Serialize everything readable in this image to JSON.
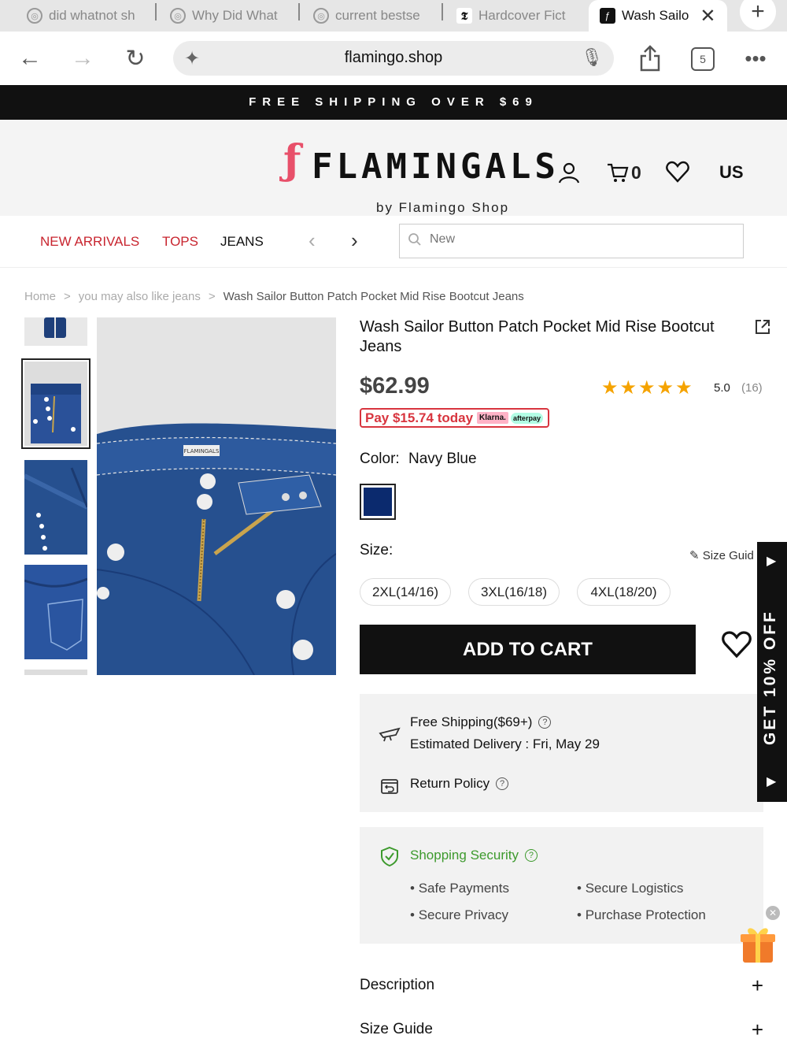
{
  "browser": {
    "tabs": [
      {
        "label": "did whatnot sh"
      },
      {
        "label": "Why Did What"
      },
      {
        "label": "current bestse"
      },
      {
        "label": "Hardcover Fict"
      },
      {
        "label": "Wash Sailo"
      }
    ],
    "url": "flamingo.shop",
    "tab_count": "5"
  },
  "promo_bar": "FREE SHIPPING OVER $69",
  "header": {
    "brand": "FLAMINGALS",
    "tagline": "by Flamingo Shop",
    "cart_count": "0",
    "region": "US"
  },
  "nav": {
    "items": [
      "NEW ARRIVALS",
      "TOPS",
      "JEANS"
    ],
    "search_placeholder": "New"
  },
  "breadcrumb": [
    "Home",
    "you may also like jeans",
    "Wash Sailor Button Patch Pocket Mid Rise Bootcut Jeans"
  ],
  "breadcrumb_sep": ">",
  "product": {
    "title": "Wash Sailor Button Patch Pocket Mid Rise Bootcut Jeans",
    "price": "$62.99",
    "stars": "★★★★★",
    "rating": "5.0",
    "review_count": "(16)",
    "pay_today": "Pay $15.74 today",
    "klarna": "Klarna.",
    "afterpay": "afterpay",
    "color_label": "Color:",
    "color_value": "Navy Blue",
    "swatch_color": "#0b2a6e",
    "size_label": "Size:",
    "size_guide": "Size Guid",
    "sizes": [
      "2XL(14/16)",
      "3XL(16/18)",
      "4XL(18/20)"
    ],
    "add_to_cart": "ADD TO CART"
  },
  "shipping": {
    "free_shipping": "Free Shipping($69+)",
    "delivery": "Estimated Delivery : Fri, May 29",
    "return_policy": "Return Policy"
  },
  "security": {
    "title": "Shopping Security",
    "points": [
      "Safe Payments",
      "Secure Logistics",
      "Secure Privacy",
      "Purchase Protection"
    ]
  },
  "accordions": [
    "Description",
    "Size Guide"
  ],
  "side_promo": "GET 10% OFF",
  "colors": {
    "accent_red": "#c8252f",
    "promo_bg": "#111111",
    "security_green": "#3d9a2d",
    "star": "#f5a300"
  }
}
